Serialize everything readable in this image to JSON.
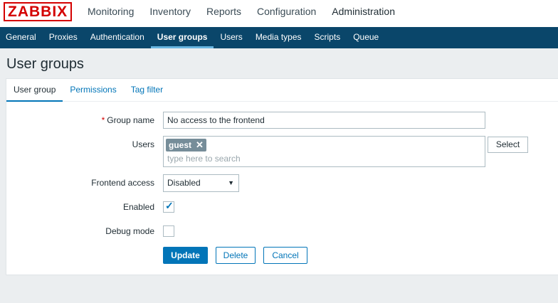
{
  "brand": {
    "logo_text": "ZABBIX",
    "color": "#d40000"
  },
  "top_menu": [
    {
      "label": "Monitoring",
      "active": false
    },
    {
      "label": "Inventory",
      "active": false
    },
    {
      "label": "Reports",
      "active": false
    },
    {
      "label": "Configuration",
      "active": false
    },
    {
      "label": "Administration",
      "active": true
    }
  ],
  "sub_menu": [
    {
      "label": "General",
      "active": false
    },
    {
      "label": "Proxies",
      "active": false
    },
    {
      "label": "Authentication",
      "active": false
    },
    {
      "label": "User groups",
      "active": true
    },
    {
      "label": "Users",
      "active": false
    },
    {
      "label": "Media types",
      "active": false
    },
    {
      "label": "Scripts",
      "active": false
    },
    {
      "label": "Queue",
      "active": false
    }
  ],
  "page": {
    "title": "User groups"
  },
  "tabs": [
    {
      "label": "User group",
      "active": true
    },
    {
      "label": "Permissions",
      "active": false
    },
    {
      "label": "Tag filter",
      "active": false
    }
  ],
  "form": {
    "required_marker": "*",
    "group_name": {
      "label": "Group name",
      "value": "No access to the frontend"
    },
    "users": {
      "label": "Users",
      "selected": [
        "guest"
      ],
      "remove_icon": "close-icon",
      "placeholder": "type here to search",
      "select_button": "Select"
    },
    "frontend_access": {
      "label": "Frontend access",
      "value": "Disabled"
    },
    "enabled": {
      "label": "Enabled",
      "checked": true
    },
    "debug_mode": {
      "label": "Debug mode",
      "checked": false
    },
    "buttons": {
      "update": "Update",
      "delete": "Delete",
      "cancel": "Cancel"
    }
  },
  "colors": {
    "accent": "#0275b8",
    "subnav_bg": "#0a466a",
    "tag_bg": "#768d99"
  }
}
